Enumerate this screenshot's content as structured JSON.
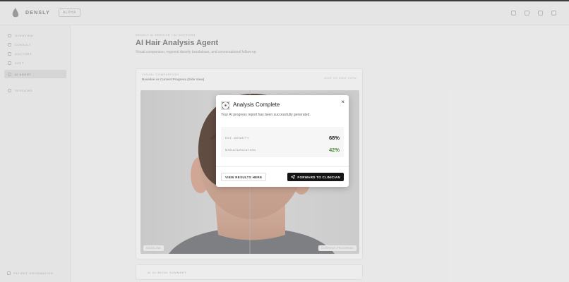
{
  "topbar": {
    "brand": "DENSLY",
    "badge": "ALPHA",
    "icons": [
      "grid-icon",
      "refresh-icon",
      "bell-icon",
      "menu-icon"
    ]
  },
  "sidebar": {
    "items": [
      {
        "label": "OVERVIEW",
        "icon": "home-icon",
        "active": false
      },
      {
        "label": "CONSULT",
        "icon": "user-icon",
        "active": false
      },
      {
        "label": "DOCTORS",
        "icon": "doctor-icon",
        "active": false
      },
      {
        "label": "VISIT",
        "icon": "calendar-icon",
        "active": false
      },
      {
        "label": "AI AGENT",
        "icon": "ai-icon",
        "active": true
      },
      {
        "label": "SESSIONS",
        "icon": "clock-icon",
        "active": false
      }
    ],
    "footer": "PATIENT INFORMATION"
  },
  "main": {
    "eyebrow": "DENSLY AI SERVICE / AI DOCTORS",
    "title": "AI Hair Analysis Agent",
    "subtitle": "Visual comparison, regional density breakdown, and conversational follow-up.",
    "card": {
      "eyebrow": "VISUAL COMPARISON",
      "title": "Baseline vs Current Progress (Side View)",
      "meta": "SIDE VS SIDE VIEW",
      "tag_left": "BASELINE",
      "tag_right": "CURRENT PROGRESS"
    },
    "summary_label": "AI CLINICAL SUMMARY"
  },
  "modal": {
    "title": "Analysis Complete",
    "description": "Your AI progress report has been successfully generated.",
    "close_label": "×",
    "stats": [
      {
        "label": "EST. DENSITY",
        "value": "68%"
      },
      {
        "label": "MINIATURIZATION",
        "value": "42%"
      }
    ],
    "view_button": "VIEW RESULTS HERE",
    "forward_button": "FORWARD TO CLINICIAN"
  },
  "colors": {
    "accent_dark": "#151515",
    "positive_green": "#4a8a3b"
  }
}
